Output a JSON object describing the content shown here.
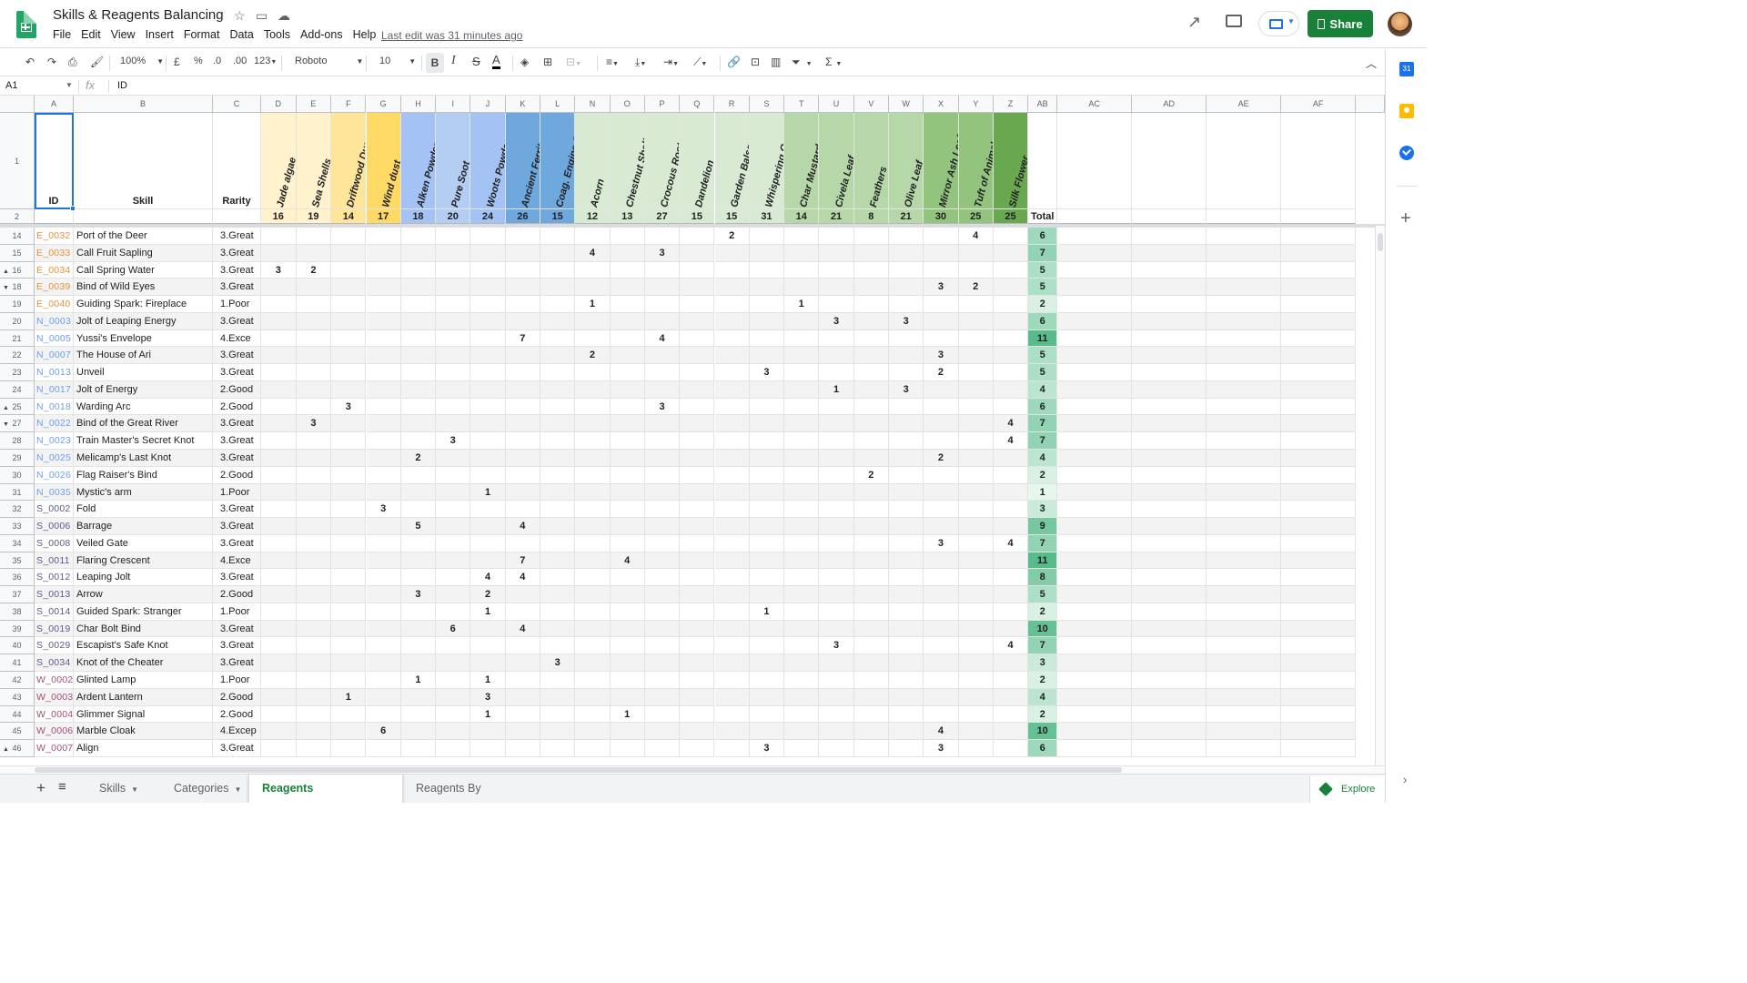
{
  "app": {
    "doc_title": "Skills & Reagents Balancing",
    "menus": [
      "File",
      "Edit",
      "View",
      "Insert",
      "Format",
      "Data",
      "Tools",
      "Add-ons",
      "Help"
    ],
    "last_edit": "Last edit was 31 minutes ago",
    "share_label": "Share"
  },
  "toolbar": {
    "zoom": "100%",
    "currency": "£",
    "percent": "%",
    "decrease_decimal": ".0",
    "increase_decimal": ".00",
    "number_format": "123",
    "font": "Roboto",
    "font_size": "10",
    "bold": "B",
    "italic": "I",
    "strike": "S",
    "text_color": "A",
    "function": "Σ"
  },
  "formula_bar": {
    "name_box": "A1",
    "fx": "fx",
    "value": "ID"
  },
  "column_letters": [
    "A",
    "B",
    "C",
    "D",
    "E",
    "F",
    "G",
    "H",
    "I",
    "J",
    "K",
    "L",
    "N",
    "O",
    "P",
    "Q",
    "R",
    "S",
    "T",
    "U",
    "V",
    "W",
    "X",
    "Y",
    "Z",
    "AB",
    "AC",
    "AD",
    "AE",
    "AF"
  ],
  "header_row": {
    "id": "ID",
    "skill": "Skill",
    "rarity": "Rarity",
    "total_label": "Total"
  },
  "reagents": [
    {
      "name": "Jade algae",
      "total": 16,
      "color": "#fff2cc"
    },
    {
      "name": "Sea Shells",
      "total": 19,
      "color": "#fff2cc"
    },
    {
      "name": "Driftwood Dust",
      "total": 14,
      "color": "#ffe599"
    },
    {
      "name": "Wind dust",
      "total": 17,
      "color": "#ffd966"
    },
    {
      "name": "Alken Powder",
      "total": 18,
      "color": "#a4c2f4"
    },
    {
      "name": "Pure Soot",
      "total": 20,
      "color": "#b4cdf2"
    },
    {
      "name": "Woots Powder",
      "total": 24,
      "color": "#a4c2f4"
    },
    {
      "name": "Ancient Ferrite Grain",
      "total": 26,
      "color": "#6fa8dc"
    },
    {
      "name": "Coag. Engine Oil",
      "total": 15,
      "color": "#6fa8dc"
    },
    {
      "name": "Acorn",
      "total": 12,
      "color": "#d9ead3"
    },
    {
      "name": "Chestnut Shells",
      "total": 13,
      "color": "#d9ead3"
    },
    {
      "name": "Crocous Root",
      "total": 27,
      "color": "#d9ead3"
    },
    {
      "name": "Dandelion",
      "total": 15,
      "color": "#d9ead3"
    },
    {
      "name": "Garden Balsam",
      "total": 15,
      "color": "#d9ead3"
    },
    {
      "name": "Whispering Orchid",
      "total": 31,
      "color": "#d9ead3"
    },
    {
      "name": "Char Mustard",
      "total": 14,
      "color": "#b6d7a8"
    },
    {
      "name": "Civela Leaf",
      "total": 21,
      "color": "#b6d7a8"
    },
    {
      "name": "Feathers",
      "total": 8,
      "color": "#b6d7a8"
    },
    {
      "name": "Olive Leaf",
      "total": 21,
      "color": "#b6d7a8"
    },
    {
      "name": "Mirror Ash Leaf",
      "total": 30,
      "color": "#93c47d"
    },
    {
      "name": "Tuft of Animal Hair",
      "total": 25,
      "color": "#93c47d"
    },
    {
      "name": "Silk Flower",
      "total": 25,
      "color": "#6aa84f"
    }
  ],
  "rows": [
    {
      "row": 14,
      "id": "E_0032",
      "skill": "Port of the Deer",
      "rarity": "3.Great",
      "cells": {
        "13": 2,
        "20": 4
      },
      "total": 6
    },
    {
      "row": 15,
      "id": "E_0033",
      "skill": "Call Fruit Sapling",
      "rarity": "3.Great",
      "cells": {
        "9": 4,
        "11": 3
      },
      "total": 7
    },
    {
      "row": 16,
      "id": "E_0034",
      "skill": "Call Spring Water",
      "rarity": "3.Great",
      "cells": {
        "0": 3,
        "1": 2
      },
      "total": 5
    },
    {
      "row": 18,
      "id": "E_0039",
      "skill": "Bind of Wild Eyes",
      "rarity": "3.Great",
      "cells": {
        "19": 3,
        "20": 2
      },
      "total": 5
    },
    {
      "row": 19,
      "id": "E_0040",
      "skill": "Guiding Spark: Fireplace",
      "rarity": "1.Poor",
      "cells": {
        "9": 1,
        "15": 1
      },
      "total": 2
    },
    {
      "row": 20,
      "id": "N_0003",
      "skill": "Jolt of Leaping Energy",
      "rarity": "3.Great",
      "cells": {
        "16": 3,
        "18": 3
      },
      "total": 6
    },
    {
      "row": 21,
      "id": "N_0005",
      "skill": "Yussi's Envelope",
      "rarity": "4.Exce",
      "cells": {
        "7": 7,
        "11": 4
      },
      "total": 11
    },
    {
      "row": 22,
      "id": "N_0007",
      "skill": "The House of Ari",
      "rarity": "3.Great",
      "cells": {
        "9": 2,
        "19": 3
      },
      "total": 5
    },
    {
      "row": 23,
      "id": "N_0013",
      "skill": "Unveil",
      "rarity": "3.Great",
      "cells": {
        "14": 3,
        "19": 2
      },
      "total": 5
    },
    {
      "row": 24,
      "id": "N_0017",
      "skill": "Jolt of Energy",
      "rarity": "2.Good",
      "cells": {
        "16": 1,
        "18": 3
      },
      "total": 4
    },
    {
      "row": 25,
      "id": "N_0018",
      "skill": "Warding Arc",
      "rarity": "2.Good",
      "cells": {
        "2": 3,
        "11": 3
      },
      "total": 6
    },
    {
      "row": 27,
      "id": "N_0022",
      "skill": "Bind of the Great River",
      "rarity": "3.Great",
      "cells": {
        "1": 3,
        "21": 4
      },
      "total": 7
    },
    {
      "row": 28,
      "id": "N_0023",
      "skill": "Train Master's Secret Knot",
      "rarity": "3.Great",
      "cells": {
        "5": 3,
        "21": 4
      },
      "total": 7
    },
    {
      "row": 29,
      "id": "N_0025",
      "skill": "Melicamp's Last Knot",
      "rarity": "3.Great",
      "cells": {
        "4": 2,
        "19": 2
      },
      "total": 4
    },
    {
      "row": 30,
      "id": "N_0026",
      "skill": "Flag Raiser's Bind",
      "rarity": "2.Good",
      "cells": {
        "17": 2
      },
      "total": 2
    },
    {
      "row": 31,
      "id": "N_0035",
      "skill": "Mystic's arm",
      "rarity": "1.Poor",
      "cells": {
        "6": 1
      },
      "total": 1
    },
    {
      "row": 32,
      "id": "S_0002",
      "skill": "Fold",
      "rarity": "3.Great",
      "cells": {
        "3": 3
      },
      "total": 3
    },
    {
      "row": 33,
      "id": "S_0006",
      "skill": "Barrage",
      "rarity": "3.Great",
      "cells": {
        "4": 5,
        "7": 4
      },
      "total": 9
    },
    {
      "row": 34,
      "id": "S_0008",
      "skill": "Veiled Gate",
      "rarity": "3.Great",
      "cells": {
        "19": 3,
        "21": 4
      },
      "total": 7
    },
    {
      "row": 35,
      "id": "S_0011",
      "skill": "Flaring Crescent",
      "rarity": "4.Exce",
      "cells": {
        "7": 7,
        "10": 4
      },
      "total": 11
    },
    {
      "row": 36,
      "id": "S_0012",
      "skill": "Leaping Jolt",
      "rarity": "3.Great",
      "cells": {
        "6": 4,
        "7": 4
      },
      "total": 8
    },
    {
      "row": 37,
      "id": "S_0013",
      "skill": "Arrow",
      "rarity": "2.Good",
      "cells": {
        "4": 3,
        "6": 2
      },
      "total": 5
    },
    {
      "row": 38,
      "id": "S_0014",
      "skill": "Guided Spark: Stranger",
      "rarity": "1.Poor",
      "cells": {
        "6": 1,
        "14": 1
      },
      "total": 2
    },
    {
      "row": 39,
      "id": "S_0019",
      "skill": "Char Bolt Bind",
      "rarity": "3.Great",
      "cells": {
        "5": 6,
        "7": 4
      },
      "total": 10
    },
    {
      "row": 40,
      "id": "S_0029",
      "skill": "Escapist's Safe Knot",
      "rarity": "3.Great",
      "cells": {
        "16": 3,
        "21": 4
      },
      "total": 7
    },
    {
      "row": 41,
      "id": "S_0034",
      "skill": "Knot of the Cheater",
      "rarity": "3.Great",
      "cells": {
        "8": 3
      },
      "total": 3
    },
    {
      "row": 42,
      "id": "W_0002",
      "skill": "Glinted Lamp",
      "rarity": "1.Poor",
      "cells": {
        "4": 1,
        "6": 1
      },
      "total": 2
    },
    {
      "row": 43,
      "id": "W_0003",
      "skill": "Ardent Lantern",
      "rarity": "2.Good",
      "cells": {
        "2": 1,
        "6": 3
      },
      "total": 4
    },
    {
      "row": 44,
      "id": "W_0004",
      "skill": "Glimmer Signal",
      "rarity": "2.Good",
      "cells": {
        "6": 1,
        "10": 1
      },
      "total": 2
    },
    {
      "row": 45,
      "id": "W_0006",
      "skill": "Marble Cloak",
      "rarity": "4.Excep",
      "cells": {
        "3": 6,
        "19": 4
      },
      "total": 10
    },
    {
      "row": 46,
      "id": "W_0007",
      "skill": "Align",
      "rarity": "3.Great",
      "cells": {
        "14": 3,
        "19": 3
      },
      "total": 6
    }
  ],
  "id_colors": {
    "E": "#e69138",
    "N": "#6d9eeb",
    "S": "#5b5b8a",
    "W": "#a64d79"
  },
  "sheet_tabs": [
    "Skills",
    "Categories",
    "Reagents Requirement",
    "Reagents By Scene"
  ],
  "active_tab": 2,
  "explore_label": "Explore"
}
